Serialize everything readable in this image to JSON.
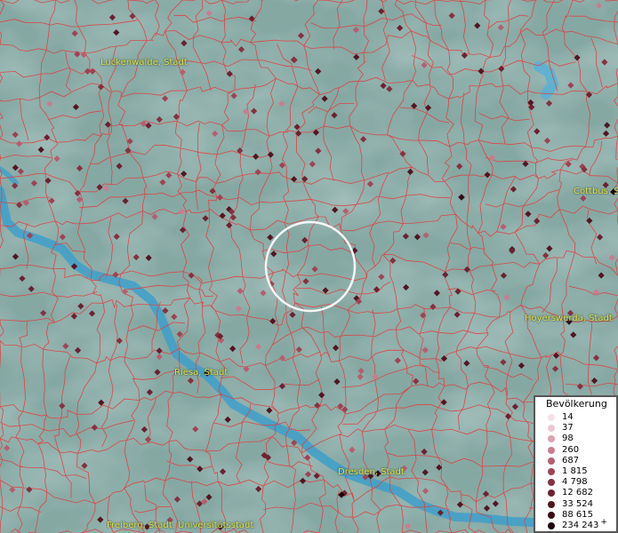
{
  "map": {
    "city_labels": [
      "Luckenwalde, Stadt",
      "Cottbus, St",
      "Hoyerswerda, Stadt",
      "Riesa, Stadt",
      "Dresden, Stadt",
      "Freiberg, Stadt, Universitätsstadt"
    ],
    "colors": {
      "terrain": "#86a8a3",
      "water": "#3e9fca",
      "boundary": "#e23b3b",
      "label": "#e9e34a"
    }
  },
  "legend": {
    "title": "Bevölkerung",
    "items": [
      {
        "label": "14",
        "color": "#f6e1ea"
      },
      {
        "label": "37",
        "color": "#eec6d1"
      },
      {
        "label": "98",
        "color": "#dda2b0"
      },
      {
        "label": "260",
        "color": "#c87d8e"
      },
      {
        "label": "687",
        "color": "#b45f70"
      },
      {
        "label": "1 815",
        "color": "#9c4455"
      },
      {
        "label": "4 798",
        "color": "#843240"
      },
      {
        "label": "12 682",
        "color": "#6a2231"
      },
      {
        "label": "33 524",
        "color": "#511622"
      },
      {
        "label": "88 615",
        "color": "#380c16"
      },
      {
        "label": "234 243",
        "color": "#1b0309",
        "suffix": "+"
      }
    ]
  }
}
